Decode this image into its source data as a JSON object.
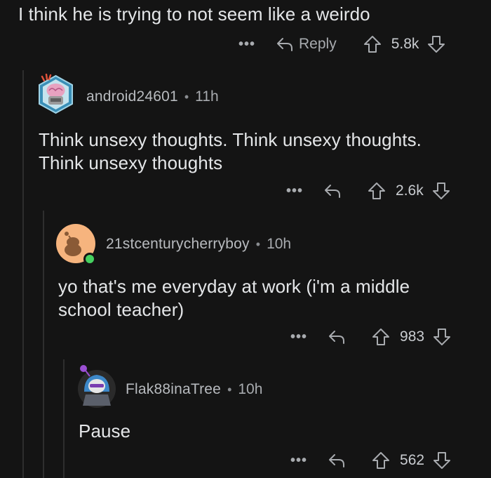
{
  "top_comment": {
    "text": "I think he is trying to not seem like a weirdo",
    "reply_label": "Reply",
    "votes": "5.8k"
  },
  "comments": [
    {
      "username": "android24601",
      "time": "11h",
      "text": "Think unsexy thoughts. Think unsexy thoughts.\nThink unsexy thoughts",
      "votes": "2.6k",
      "avatar_icon": "avatar-brain-icon"
    },
    {
      "username": "21stcenturycherryboy",
      "time": "10h",
      "text": "yo that's me everyday at work (i'm a middle\nschool teacher)",
      "votes": "983",
      "avatar_icon": "avatar-snoo-icon",
      "online_color": "#46d160"
    },
    {
      "username": "Flak88inaTree",
      "time": "10h",
      "text": "Pause",
      "votes": "562",
      "avatar_icon": "avatar-masked-icon"
    }
  ],
  "icons": {
    "more": "more-options-icon",
    "reply": "reply-arrow-icon",
    "upvote": "upvote-arrow-icon",
    "downvote": "downvote-arrow-icon"
  },
  "colors": {
    "background": "#141414",
    "text": "#e4e6e8",
    "muted": "#a8abaf",
    "thread_line": "#2e2e2e"
  }
}
